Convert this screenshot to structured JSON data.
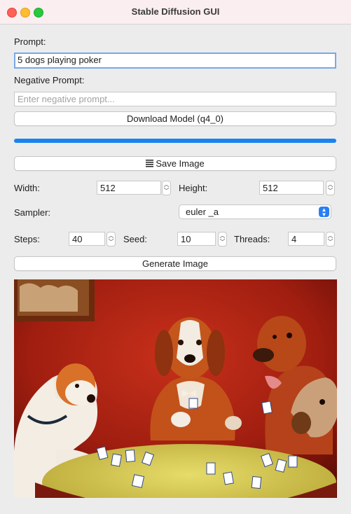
{
  "window": {
    "title": "Stable Diffusion GUI"
  },
  "prompt": {
    "label": "Prompt:",
    "value": "5 dogs playing poker"
  },
  "negative_prompt": {
    "label": "Negative Prompt:",
    "placeholder": "Enter negative prompt..."
  },
  "download_button": {
    "label": "Download Model (q4_0)"
  },
  "progress": {
    "fraction": 1.0,
    "color": "#1b83f0"
  },
  "save_button": {
    "icon": "save-icon",
    "label": "Save Image"
  },
  "width": {
    "label": "Width:",
    "value": "512"
  },
  "height": {
    "label": "Height:",
    "value": "512"
  },
  "sampler": {
    "label": "Sampler:",
    "value": "euler _a"
  },
  "steps": {
    "label": "Steps:",
    "value": "40"
  },
  "seed": {
    "label": "Seed:",
    "value": "10"
  },
  "threads": {
    "label": "Threads:",
    "value": "4"
  },
  "generate_button": {
    "label": "Generate Image"
  },
  "output_image": {
    "subject": "dogs playing poker painting"
  }
}
